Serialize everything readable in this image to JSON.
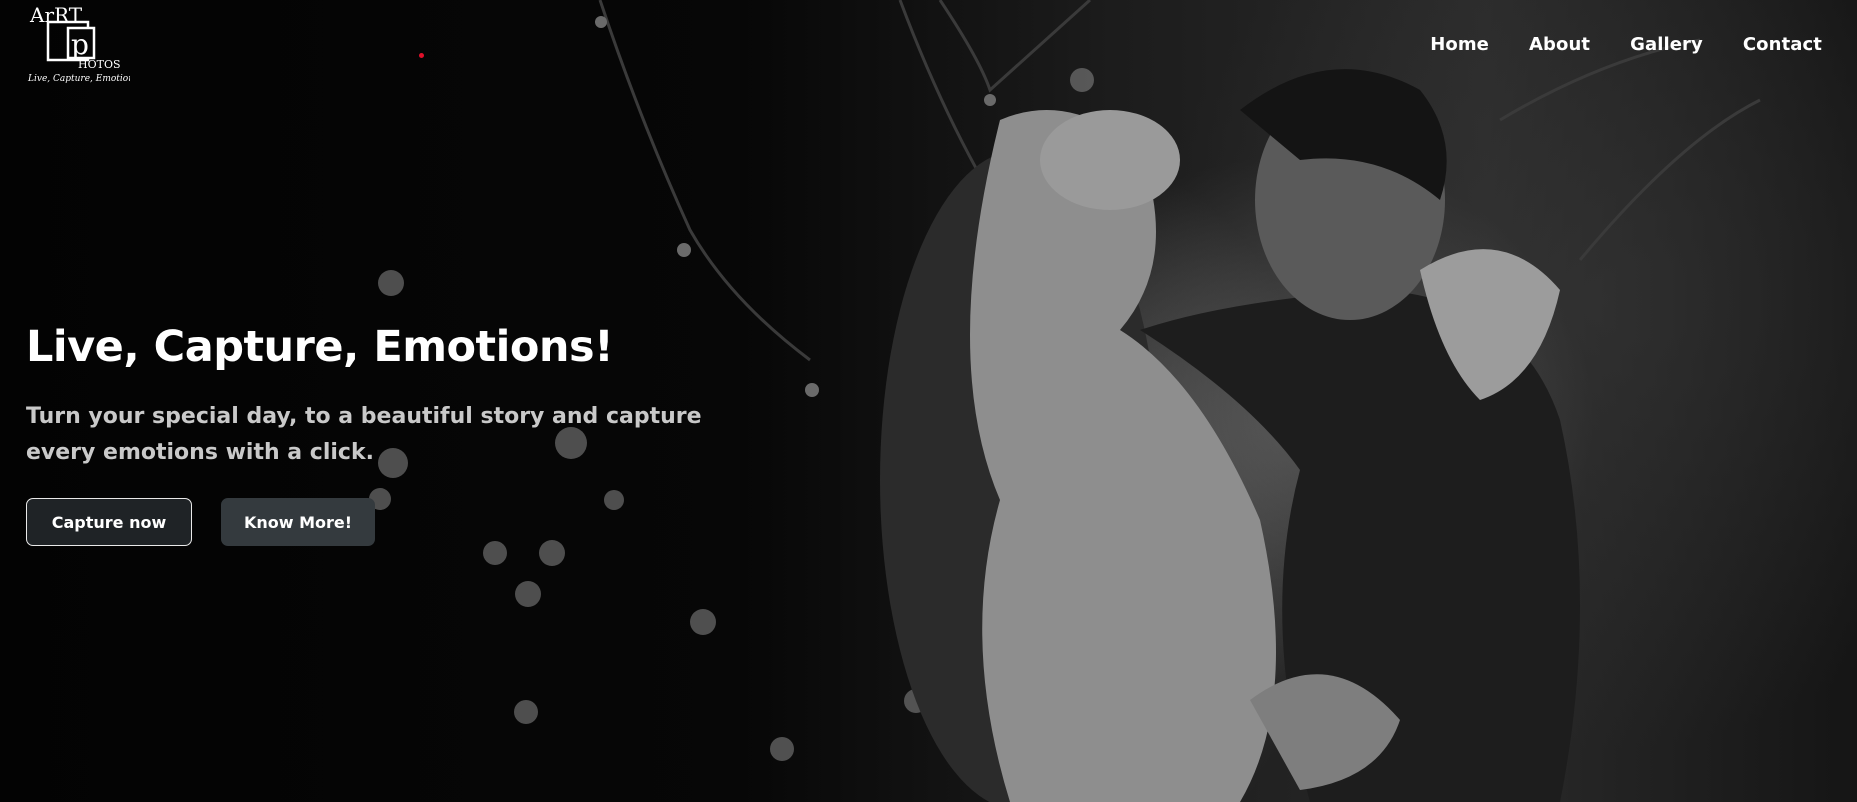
{
  "brand": {
    "logo_top": "ArRT",
    "logo_letter": "p",
    "logo_bottom": "HOTOS",
    "tagline": "Live, Capture, Emotion!"
  },
  "nav": {
    "items": [
      {
        "label": "Home"
      },
      {
        "label": "About"
      },
      {
        "label": "Gallery"
      },
      {
        "label": "Contact"
      }
    ]
  },
  "hero": {
    "headline": "Live, Capture, Emotions!",
    "subtext": "Turn your special day, to a beautiful story and capture every emotions with a click.",
    "primary_button": "Capture now",
    "secondary_button": "Know More!",
    "image": "black-and-white couple photo with bokeh lights"
  },
  "colors": {
    "background": "#050505",
    "text": "#ffffff",
    "subtext": "#c9c9c9",
    "primary_button_bg": "#1f2326",
    "secondary_button_bg": "#343a3e",
    "accent_dot": "#e0102a"
  }
}
